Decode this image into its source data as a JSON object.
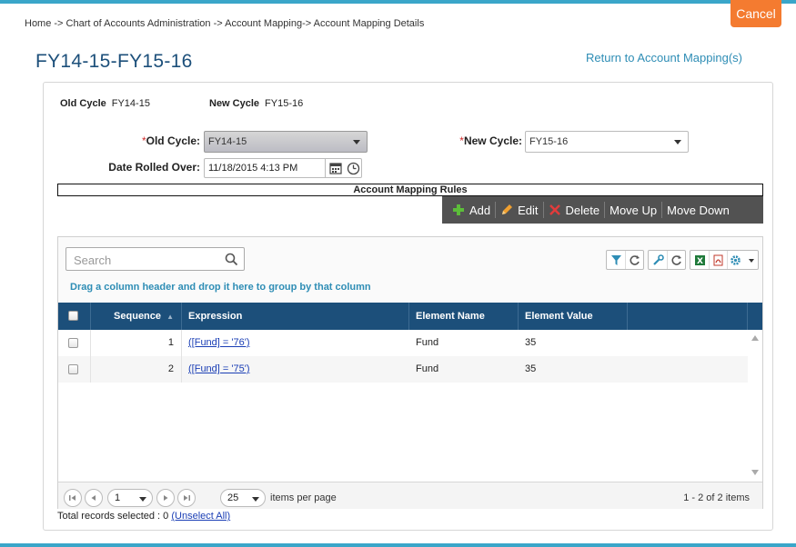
{
  "breadcrumb": "Home -> Chart of Accounts Administration -> Account Mapping-> Account Mapping Details",
  "cancel_label": "Cancel",
  "page_title": "FY14-15-FY15-16",
  "return_link": "Return to Account Mapping(s)",
  "info": {
    "old_cycle_label": "Old Cycle",
    "old_cycle_value": "FY14-15",
    "new_cycle_label": "New Cycle",
    "new_cycle_value": "FY15-16"
  },
  "form": {
    "required_mark": "*",
    "old_cycle_label": "Old Cycle:",
    "old_cycle_selected": "FY14-15",
    "new_cycle_label": "New Cycle:",
    "new_cycle_selected": "FY15-16",
    "date_label": "Date Rolled Over:",
    "date_value": "11/18/2015 4:13 PM"
  },
  "rules_title": "Account Mapping Rules",
  "toolbar": {
    "add": "Add",
    "edit": "Edit",
    "delete": "Delete",
    "move_up": "Move Up",
    "move_down": "Move Down"
  },
  "grid": {
    "search_placeholder": "Search",
    "group_hint": "Drag a column header and drop it here to group by that column",
    "columns": [
      "Sequence",
      "Expression",
      "Element Name",
      "Element Value"
    ],
    "sort_indicator": "▲",
    "rows": [
      {
        "sequence": "1",
        "expression": "([Fund] = '76')",
        "element_name": "Fund",
        "element_value": "35"
      },
      {
        "sequence": "2",
        "expression": "([Fund] = '75')",
        "element_name": "Fund",
        "element_value": "35"
      }
    ]
  },
  "pager": {
    "page": "1",
    "page_size": "25",
    "items_per_page_label": "items per page",
    "range_text": "1 - 2 of 2 items"
  },
  "footer": {
    "total_selected": "Total records selected : 0",
    "unselect_all": "(Unselect All)"
  },
  "colors": {
    "accent_blue": "#1c4f7a",
    "link_blue": "#2e8db5",
    "cancel_orange": "#f47b30",
    "toolbar_dark": "#525252"
  }
}
